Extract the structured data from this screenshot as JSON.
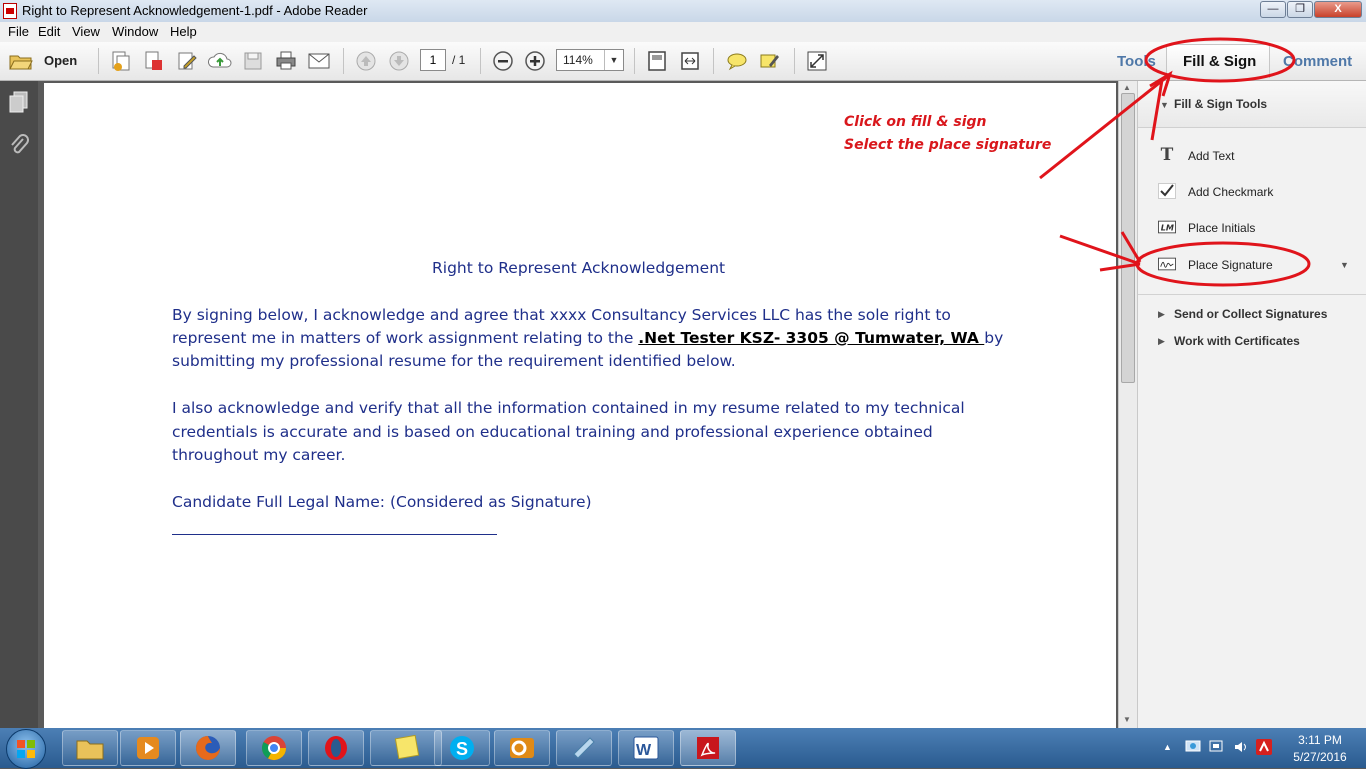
{
  "window": {
    "title": "Right to Represent Acknowledgement-1.pdf - Adobe Reader",
    "minimize": "—",
    "maximize": "❐",
    "close": "X"
  },
  "menu": [
    "File",
    "Edit",
    "View",
    "Window",
    "Help"
  ],
  "toolbar": {
    "open_label": "Open",
    "page_current": "1",
    "page_total": "/ 1",
    "zoom": "114%"
  },
  "panel_tabs": {
    "tools": "Tools",
    "fill_sign": "Fill & Sign",
    "comment": "Comment"
  },
  "document": {
    "heading": "Right to Represent Acknowledgement",
    "para1_a": "By signing below, I acknowledge and agree that xxxx Consultancy Services LLC has the sole right to",
    "para1_b": "represent me in matters of work assignment relating to the ",
    "para1_bold": ".Net Tester KSZ- 3305 @ Tumwater, WA ",
    "para1_c": "by",
    "para1_d": "submitting my professional resume for the requirement identified below.",
    "para2_a": "I also acknowledge and verify that all the information contained in my resume related to my technical",
    "para2_b": "credentials is accurate and is based on educational training and professional experience obtained",
    "para2_c": "throughout my career.",
    "name_label": "Candidate Full Legal Name: (Considered as Signature)"
  },
  "right_pane": {
    "section_title": "Fill & Sign Tools",
    "items": [
      {
        "label": "Add Text",
        "icon": "text-T-icon"
      },
      {
        "label": "Add Checkmark",
        "icon": "checkmark-icon"
      },
      {
        "label": "Place Initials",
        "icon": "initials-icon"
      },
      {
        "label": "Place Signature",
        "icon": "signature-icon"
      }
    ],
    "sections": [
      "Send or Collect Signatures",
      "Work with Certificates"
    ]
  },
  "annotation": {
    "line1": "Click on fill & sign",
    "line2": "Select the place signature",
    "color": "#d9171c"
  },
  "taskbar": {
    "apps": [
      "explorer-icon",
      "media-player-icon",
      "firefox-icon",
      "chrome-icon",
      "opera-icon",
      "sticky-notes-icon",
      "skype-icon",
      "outlook-icon",
      "snipping-tool-icon",
      "word-icon",
      "acrobat-reader-icon"
    ],
    "time": "3:11 PM",
    "date": "5/27/2016"
  }
}
